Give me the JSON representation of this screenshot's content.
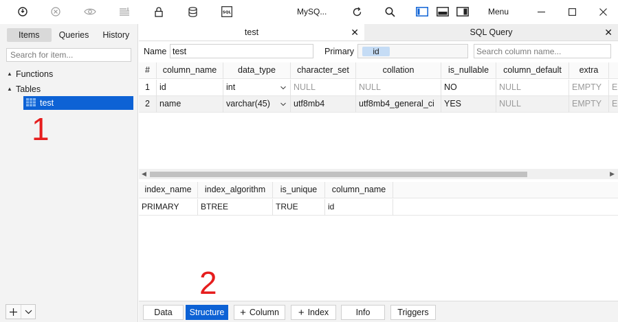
{
  "toolbar": {
    "db_label": "MySQ...",
    "menu_label": "Menu"
  },
  "sidebar": {
    "tabs": [
      "Items",
      "Queries",
      "History"
    ],
    "active_tab": "Items",
    "search_placeholder": "Search for item...",
    "tree": {
      "functions_label": "Functions",
      "tables_label": "Tables",
      "selected_table": "test"
    },
    "annotation_1": "1"
  },
  "tabs": [
    {
      "label": "test",
      "active": true
    },
    {
      "label": "SQL Query",
      "active": false
    }
  ],
  "table_info": {
    "name_label": "Name",
    "name_value": "test",
    "primary_label": "Primary",
    "primary_value": "id",
    "column_search_placeholder": "Search column name..."
  },
  "columns_grid": {
    "headers": [
      "#",
      "column_name",
      "data_type",
      "character_set",
      "collation",
      "is_nullable",
      "column_default",
      "extra"
    ],
    "rows": [
      {
        "num": "1",
        "column_name": "id",
        "data_type": "int",
        "character_set": "NULL",
        "collation": "NULL",
        "is_nullable": "NO",
        "column_default": "NULL",
        "extra": "EMPTY",
        "extra2": "EI"
      },
      {
        "num": "2",
        "column_name": "name",
        "data_type": "varchar(45)",
        "character_set": "utf8mb4",
        "collation": "utf8mb4_general_ci",
        "is_nullable": "YES",
        "column_default": "NULL",
        "extra": "EMPTY",
        "extra2": "EI"
      }
    ]
  },
  "index_grid": {
    "headers": [
      "index_name",
      "index_algorithm",
      "is_unique",
      "column_name"
    ],
    "rows": [
      {
        "index_name": "PRIMARY",
        "index_algorithm": "BTREE",
        "is_unique": "TRUE",
        "column_name": "id"
      }
    ]
  },
  "bottom_bar": {
    "buttons": [
      "Data",
      "Structure",
      "Column",
      "Index",
      "Info",
      "Triggers"
    ],
    "active": "Structure"
  },
  "annotation_2": "2",
  "colors": {
    "accent": "#0d62d5",
    "annotation": "#e61d1d",
    "sidebar_bg": "#f3f3f3"
  }
}
